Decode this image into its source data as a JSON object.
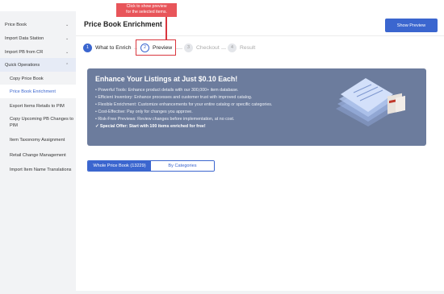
{
  "sidebar": {
    "items": [
      {
        "label": "Price Book",
        "chevron": "chevron-down-icon"
      },
      {
        "label": "Import Data Station",
        "chevron": "chevron-down-icon"
      },
      {
        "label": "Import PB from CR",
        "chevron": "chevron-down-icon"
      },
      {
        "label": "Quick Operations",
        "chevron": "chevron-up-icon"
      }
    ],
    "sub_items": [
      {
        "label": "Copy Price Book"
      },
      {
        "label": "Price Book Enrichment"
      },
      {
        "label": "Export Items Retails to PIM"
      },
      {
        "label": "Copy Upcoming PB Changes to PIM"
      },
      {
        "label": "Item Taxonomy Assignment"
      },
      {
        "label": "Retail Change Management"
      },
      {
        "label": "Import Item Name Translations"
      }
    ]
  },
  "header": {
    "title": "Price Book Enrichment",
    "show_preview_label": "Show Preview"
  },
  "tooltip": {
    "line1": "Click to show preview",
    "line2": "for the selected items."
  },
  "steps": [
    {
      "num": "1",
      "label": "What to Enrich"
    },
    {
      "num": "2",
      "label": "Preview"
    },
    {
      "num": "3",
      "label": "Checkout"
    },
    {
      "num": "4",
      "label": "Result"
    }
  ],
  "banner": {
    "title": "Enhance Your Listings at Just $0.10 Each!",
    "bullets": [
      "• Powerful Tools: Enhance product details with our 300,000+ item database.",
      "• Efficient Inventory: Enhance processes and customer trust with improved catalog.",
      "• Flexible Enrichment: Customize enhancements for your entire catalog or specific categories.",
      "• Cost-Effective: Pay only for changes you approve.",
      "• Risk-Free Previews: Review changes before implementation, at no cost.",
      "✓ Special Offer: Start with 100 items enriched for free!"
    ]
  },
  "segment": {
    "whole": "Whole Price Book (13229)",
    "categories": "By Categories"
  },
  "colors": {
    "accent": "#3b66cf",
    "highlight": "#d9363e",
    "banner_bg": "#6c7c9d"
  }
}
